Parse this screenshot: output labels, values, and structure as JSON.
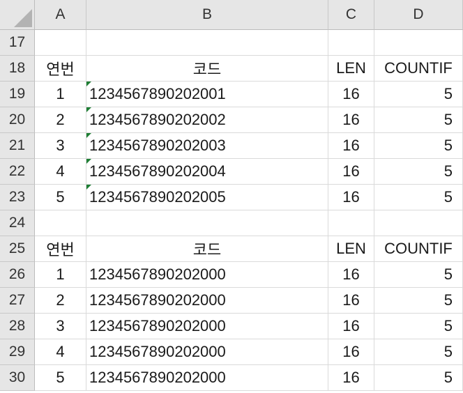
{
  "columns": [
    "A",
    "B",
    "C",
    "D"
  ],
  "rows": [
    {
      "num": "17",
      "cells": [
        "",
        "",
        "",
        ""
      ],
      "flag": false
    },
    {
      "num": "18",
      "cells": [
        "연번",
        "코드",
        "LEN",
        "COUNTIF"
      ],
      "flag": false
    },
    {
      "num": "19",
      "cells": [
        "1",
        "1234567890202001",
        "16",
        "5"
      ],
      "flag": true
    },
    {
      "num": "20",
      "cells": [
        "2",
        "1234567890202002",
        "16",
        "5"
      ],
      "flag": true
    },
    {
      "num": "21",
      "cells": [
        "3",
        "1234567890202003",
        "16",
        "5"
      ],
      "flag": true
    },
    {
      "num": "22",
      "cells": [
        "4",
        "1234567890202004",
        "16",
        "5"
      ],
      "flag": true
    },
    {
      "num": "23",
      "cells": [
        "5",
        "1234567890202005",
        "16",
        "5"
      ],
      "flag": true
    },
    {
      "num": "24",
      "cells": [
        "",
        "",
        "",
        ""
      ],
      "flag": false
    },
    {
      "num": "25",
      "cells": [
        "연번",
        "코드",
        "LEN",
        "COUNTIF"
      ],
      "flag": false
    },
    {
      "num": "26",
      "cells": [
        "1",
        "1234567890202000",
        "16",
        "5"
      ],
      "flag": false
    },
    {
      "num": "27",
      "cells": [
        "2",
        "1234567890202000",
        "16",
        "5"
      ],
      "flag": false
    },
    {
      "num": "28",
      "cells": [
        "3",
        "1234567890202000",
        "16",
        "5"
      ],
      "flag": false
    },
    {
      "num": "29",
      "cells": [
        "4",
        "1234567890202000",
        "16",
        "5"
      ],
      "flag": false
    },
    {
      "num": "30",
      "cells": [
        "5",
        "1234567890202000",
        "16",
        "5"
      ],
      "flag": false
    }
  ],
  "colors": {
    "error_flag": "#1e7e34",
    "header_bg": "#e6e6e6",
    "gridline": "#dadada"
  }
}
